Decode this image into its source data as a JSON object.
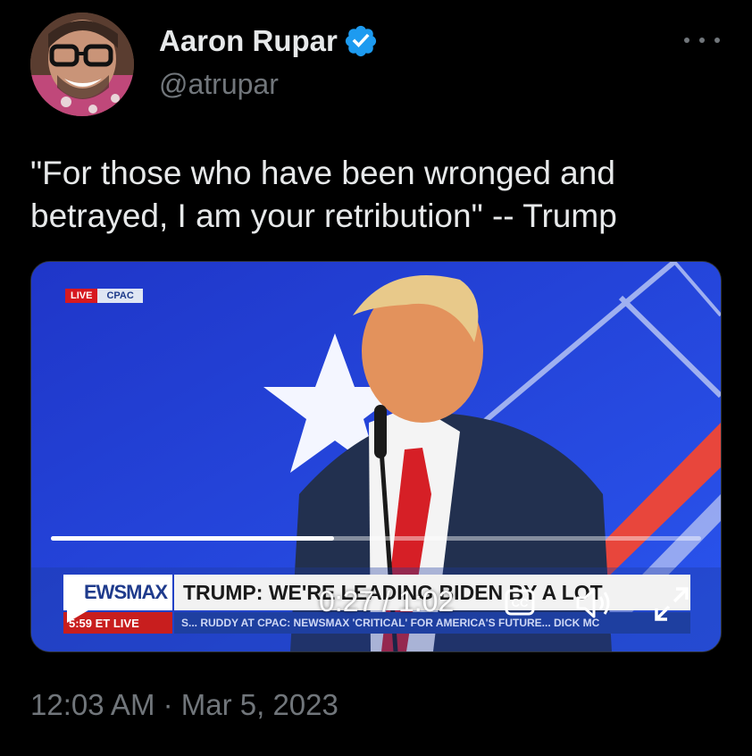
{
  "author": {
    "name": "Aaron Rupar",
    "handle": "@atrupar",
    "verified": true,
    "avatar_icon": "avatar-photo"
  },
  "tweet": {
    "text": "\"For those who have been wronged and betrayed, I am your retribution\" -- Trump",
    "timestamp": "12:03 AM · Mar 5, 2023"
  },
  "video": {
    "current_time": "0:27",
    "duration": "1:02",
    "time_display": "0:27 / 1:02",
    "progress_fraction": 0.435,
    "overlay": {
      "live_label": "LIVE",
      "event_label": "CPAC",
      "brand": "EWSMAX",
      "headline": "TRUMP: WE'RE LEADING BIDEN BY A LOT",
      "clock": "5:59 ET  LIVE",
      "ticker": "S...    RUDDY AT CPAC: NEWSMAX 'CRITICAL' FOR AMERICA'S FUTURE...    DICK MC"
    },
    "icons": {
      "play": "play-icon",
      "captions": "closed-captions-icon",
      "volume": "volume-icon",
      "fullscreen": "fullscreen-icon"
    }
  },
  "colors": {
    "background": "#000000",
    "verified_badge": "#1d9bf0",
    "muted_text": "#71767b",
    "primary_text": "#e7e9ea"
  }
}
